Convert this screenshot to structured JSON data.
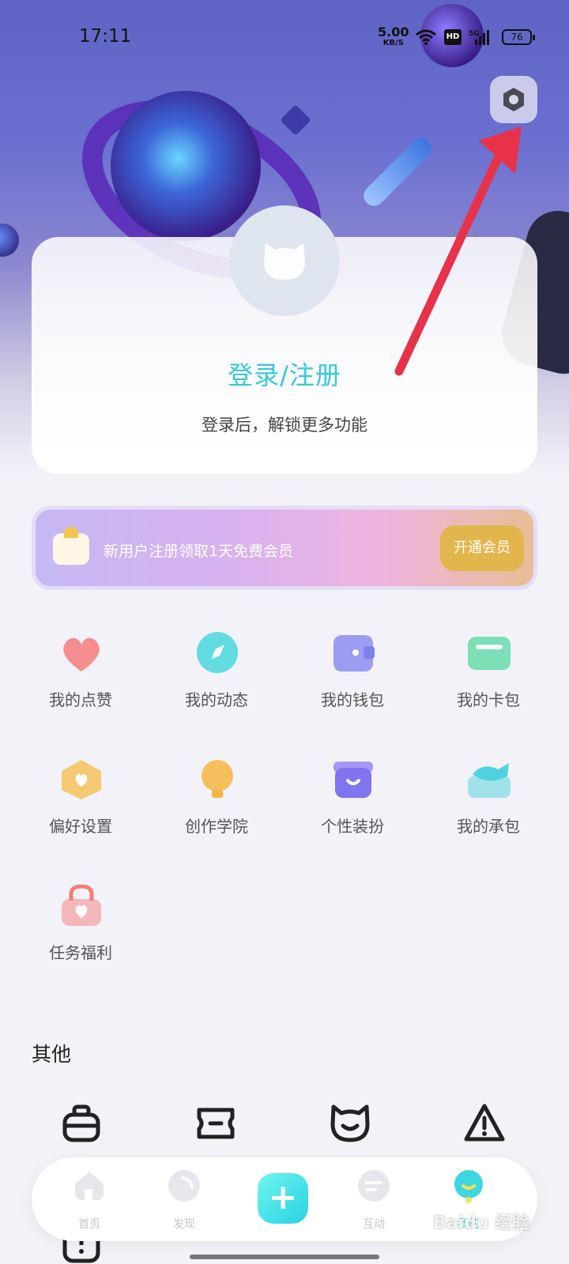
{
  "status_bar": {
    "time": "17:11",
    "net_speed": "5.00",
    "net_unit": "KB/S",
    "hd": "HD",
    "network": "5G",
    "battery": "76"
  },
  "header": {
    "settings_icon": "settings-hexagon-icon"
  },
  "login_card": {
    "title": "登录/注册",
    "subtitle": "登录后，解锁更多功能"
  },
  "vip_banner": {
    "text": "新用户注册领取1天免费会员",
    "button": "开通会员"
  },
  "menu": [
    {
      "label": "我的点赞",
      "icon": "heart-icon",
      "color": "#f47c7c"
    },
    {
      "label": "我的动态",
      "icon": "compass-icon",
      "color": "#48d8dc"
    },
    {
      "label": "我的钱包",
      "icon": "wallet-icon",
      "color": "#7f7ff0"
    },
    {
      "label": "我的卡包",
      "icon": "card-icon",
      "color": "#5ed9a4"
    },
    {
      "label": "偏好设置",
      "icon": "preference-icon",
      "color": "#f5c25b"
    },
    {
      "label": "创作学院",
      "icon": "lightbulb-icon",
      "color": "#f6b542"
    },
    {
      "label": "个性装扮",
      "icon": "store-icon",
      "color": "#8074f0"
    },
    {
      "label": "我的承包",
      "icon": "fish-icon",
      "color": "#4ed2dc"
    },
    {
      "label": "任务福利",
      "icon": "gift-bag-icon",
      "color": "#f47c7c"
    }
  ],
  "other": {
    "title": "其他",
    "icons": [
      "pot-icon",
      "ticket-icon",
      "cat-face-icon",
      "warning-icon"
    ]
  },
  "bottom_nav": [
    {
      "label": "首页",
      "icon": "home-icon"
    },
    {
      "label": "发现",
      "icon": "discover-icon"
    },
    {
      "label": "",
      "icon": "plus-icon"
    },
    {
      "label": "互动",
      "icon": "chat-icon"
    },
    {
      "label": "我的",
      "icon": "profile-icon"
    }
  ],
  "watermark": "Baidu 经验"
}
